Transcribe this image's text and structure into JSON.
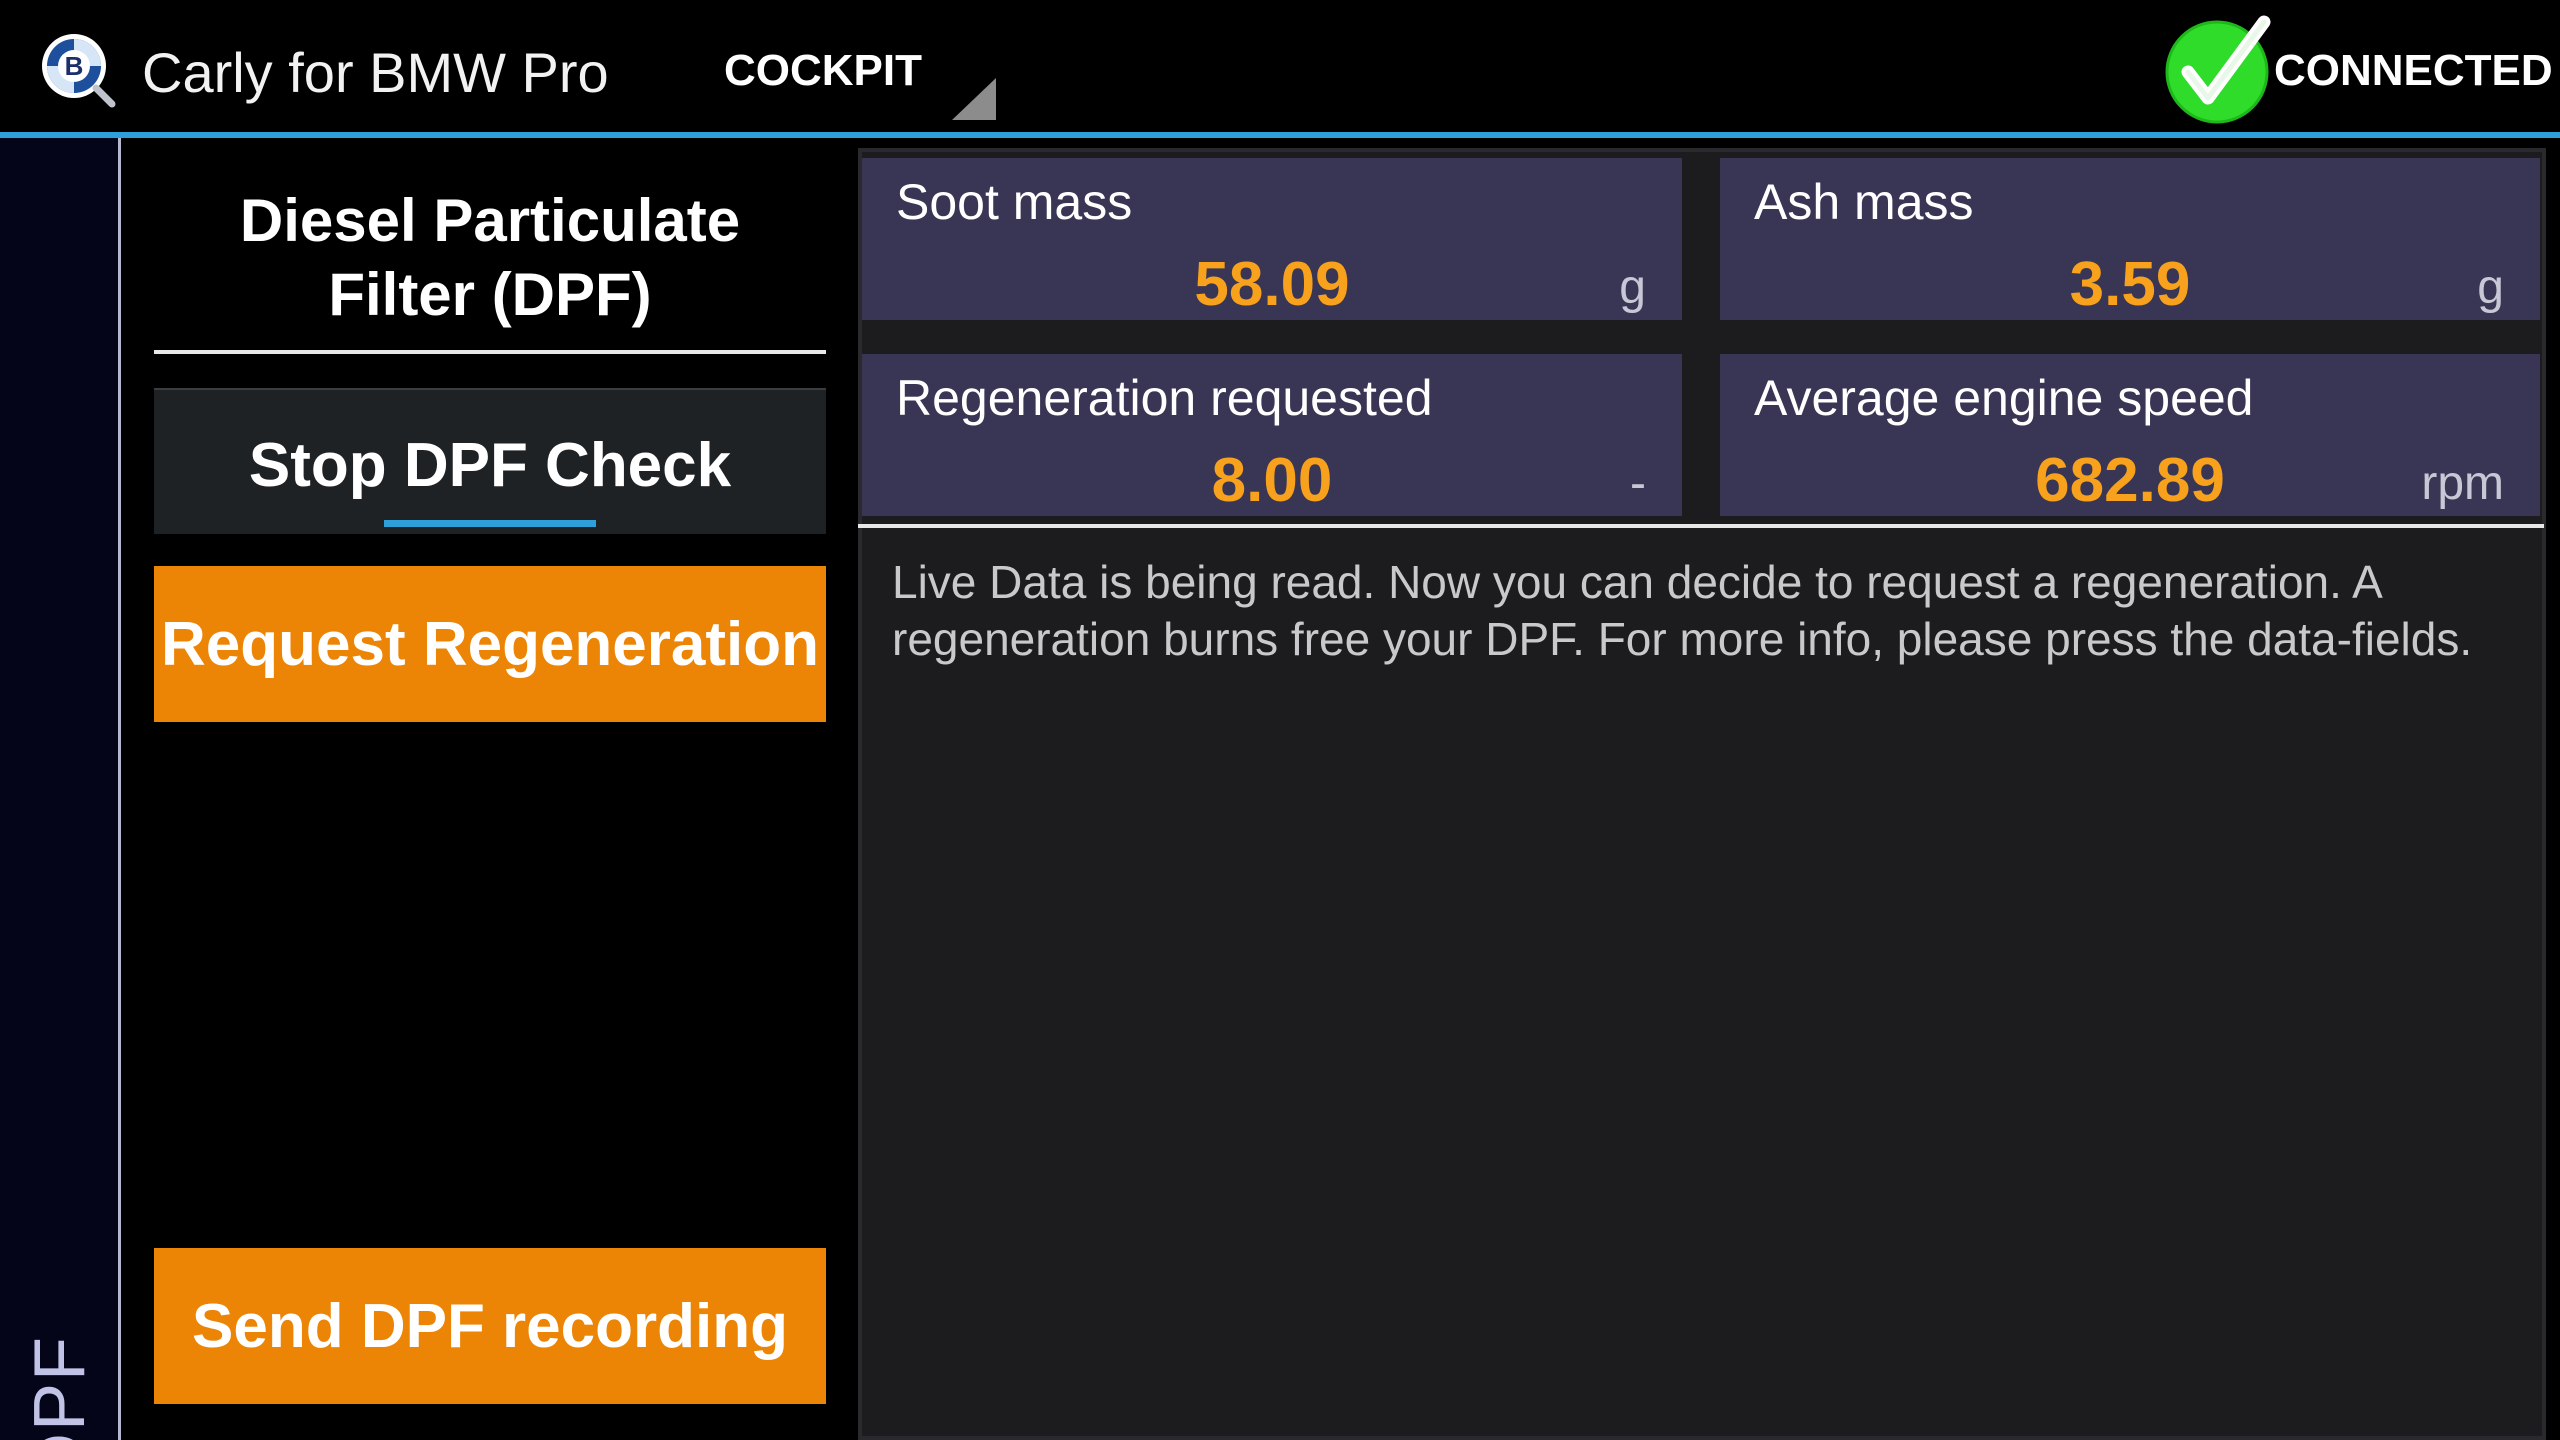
{
  "header": {
    "app_title": "Carly for BMW Pro",
    "nav_tab": "COCKPIT",
    "status": "CONNECTED",
    "colors": {
      "accent": "#2e9fd8",
      "connected": "#2fdc2a",
      "orange": "#ec8506",
      "value": "#f7a11d",
      "tile": "#383654"
    }
  },
  "side_tab": {
    "label": "DPF"
  },
  "left_panel": {
    "heading_line1": "Diesel Particulate",
    "heading_line2": "Filter (DPF)",
    "stop_button": "Stop DPF Check",
    "request_button": "Request Regeneration",
    "send_button": "Send DPF recording"
  },
  "tiles": [
    {
      "label": "Soot mass",
      "value": "58.09",
      "unit": "g"
    },
    {
      "label": "Ash mass",
      "value": "3.59",
      "unit": "g"
    },
    {
      "label": "Regeneration requested",
      "value": "8.00",
      "unit": "-"
    },
    {
      "label": "Average engine speed",
      "value": "682.89",
      "unit": "rpm"
    }
  ],
  "info": {
    "text": "Live Data is being read. Now you can decide to request a regeneration. A regeneration burns free your DPF. For more info, please press the data-fields."
  },
  "icons": {
    "app_logo": "carly-logo-icon",
    "spinner": "dropdown-triangle-icon",
    "status": "check-circle-icon"
  }
}
